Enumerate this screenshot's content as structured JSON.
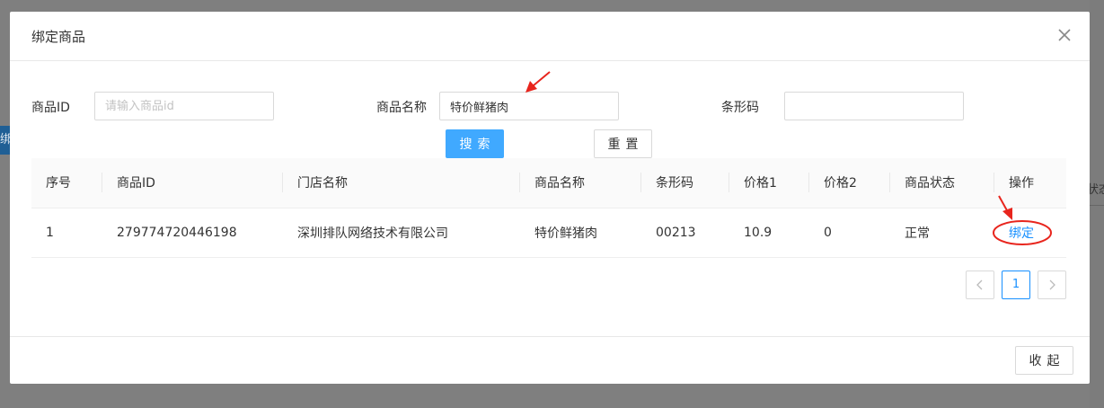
{
  "dialog": {
    "title": "绑定商品",
    "close_icon": "close-icon"
  },
  "search_form": {
    "product_id_label": "商品ID",
    "product_id_placeholder": "请输入商品id",
    "product_id_value": "",
    "product_name_label": "商品名称",
    "product_name_value": "特价鲜猪肉",
    "barcode_label": "条形码",
    "barcode_value": "",
    "search_button": "搜索",
    "reset_button": "重置"
  },
  "table": {
    "headers": [
      "序号",
      "商品ID",
      "门店名称",
      "商品名称",
      "条形码",
      "价格1",
      "价格2",
      "商品状态",
      "操作"
    ],
    "rows": [
      {
        "index": "1",
        "product_id": "279774720446198",
        "store_name": "深圳排队网络技术有限公司",
        "product_name": "特价鲜猪肉",
        "barcode": "00213",
        "price1": "10.9",
        "price2": "0",
        "status": "正常",
        "action": "绑定"
      }
    ]
  },
  "pagination": {
    "prev_icon": "chevron-left-icon",
    "current_page": "1",
    "next_icon": "chevron-right-icon"
  },
  "footer": {
    "collapse_button": "收起"
  },
  "background": {
    "left_tab_fragment": "绑",
    "right_text_fragment": "状态"
  },
  "colors": {
    "primary": "#1890ff",
    "search_button": "#40a9ff",
    "annotation_red": "#e8251d"
  }
}
